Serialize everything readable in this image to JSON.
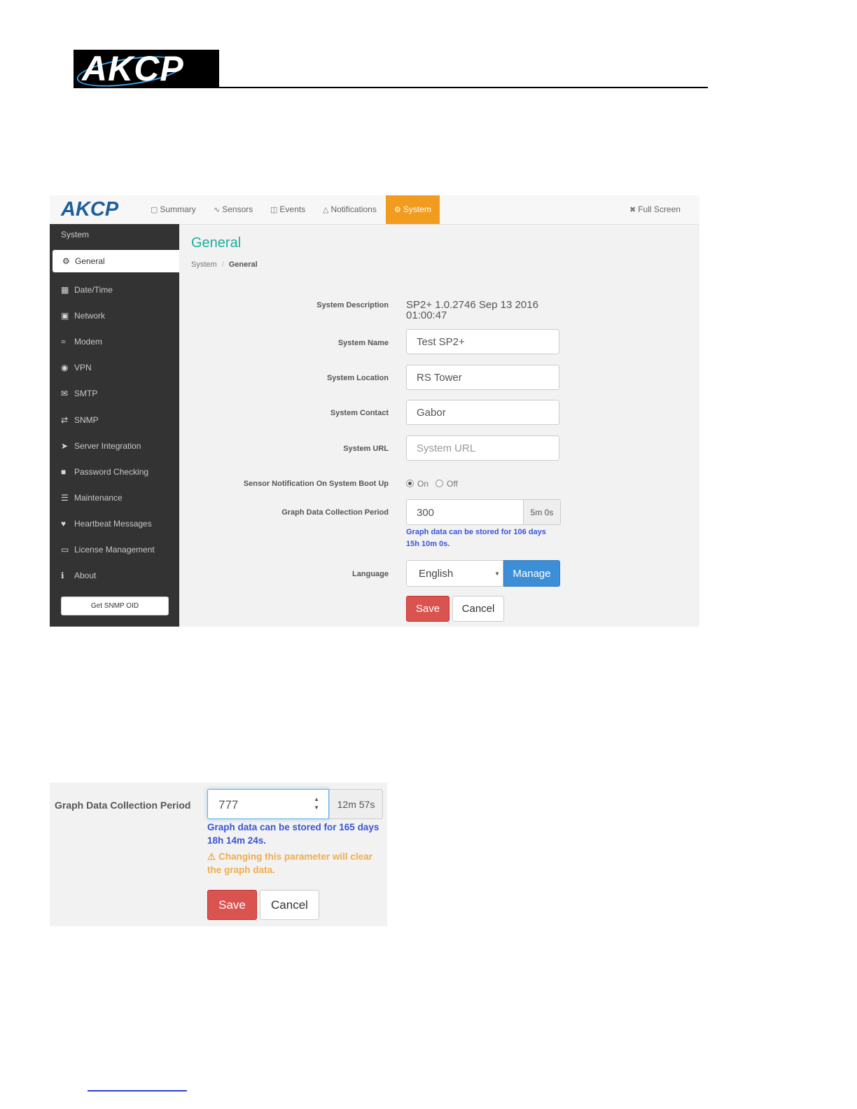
{
  "document": {
    "logo_text": "AKCP"
  },
  "app": {
    "logo_text": "AKCP",
    "nav": [
      {
        "label": "Summary",
        "icon": "monitor-icon"
      },
      {
        "label": "Sensors",
        "icon": "rss-icon"
      },
      {
        "label": "Events",
        "icon": "book-icon"
      },
      {
        "label": "Notifications",
        "icon": "bell-icon"
      },
      {
        "label": "System",
        "icon": "cogs-icon",
        "active": true
      }
    ],
    "fullscreen_label": "Full Screen"
  },
  "sidebar": {
    "heading": "System",
    "active_item": "General",
    "items": [
      {
        "label": "Date/Time",
        "icon": "calendar-icon"
      },
      {
        "label": "Network",
        "icon": "network-icon"
      },
      {
        "label": "Modem",
        "icon": "wifi-icon"
      },
      {
        "label": "VPN",
        "icon": "globe-icon"
      },
      {
        "label": "SMTP",
        "icon": "envelope-icon"
      },
      {
        "label": "SNMP",
        "icon": "exchange-icon"
      },
      {
        "label": "Server Integration",
        "icon": "paper-plane-icon"
      },
      {
        "label": "Password Checking",
        "icon": "lock-icon"
      },
      {
        "label": "Maintenance",
        "icon": "database-icon"
      },
      {
        "label": "Heartbeat Messages",
        "icon": "heart-icon"
      },
      {
        "label": "License Management",
        "icon": "credit-card-icon"
      },
      {
        "label": "About",
        "icon": "info-icon"
      }
    ],
    "snmp_button": "Get SNMP OID"
  },
  "general": {
    "title": "General",
    "breadcrumb": [
      "System",
      "General"
    ],
    "labels": {
      "description": "System Description",
      "name": "System Name",
      "location": "System Location",
      "contact": "System Contact",
      "url": "System URL",
      "notify_boot": "Sensor Notification On System Boot Up",
      "graph_period": "Graph Data Collection Period",
      "language": "Language"
    },
    "description_line1": "SP2+ 1.0.2746 Sep 13 2016",
    "description_line2": "01:00:47",
    "name_value": "Test SP2+",
    "location_value": "RS Tower",
    "contact_value": "Gabor",
    "url_placeholder": "System URL",
    "radio_on": "On",
    "radio_off": "Off",
    "radio_selected": "On",
    "graph_value": "300",
    "graph_addon": "5m 0s",
    "graph_help_line1": "Graph data can be stored for 106 days",
    "graph_help_line2": "15h 10m 0s.",
    "language_value": "English",
    "manage_label": "Manage",
    "save_label": "Save",
    "cancel_label": "Cancel"
  },
  "detail": {
    "label": "Graph Data Collection Period",
    "value": "777",
    "addon": "12m 57s",
    "help_line1": "Graph data can be stored for 165 days",
    "help_line2": "18h 14m 24s.",
    "warn_line1": "Changing this parameter will clear",
    "warn_line2": "the graph data.",
    "save_label": "Save",
    "cancel_label": "Cancel"
  },
  "colors": {
    "accent_orange": "#f29c1f",
    "title_teal": "#1aae9f",
    "help_blue": "#3a54d8",
    "warn_orange": "#f0ad4e",
    "save_red": "#d9534f",
    "manage_blue": "#3c8fd6",
    "sidebar_dark": "#333333"
  }
}
